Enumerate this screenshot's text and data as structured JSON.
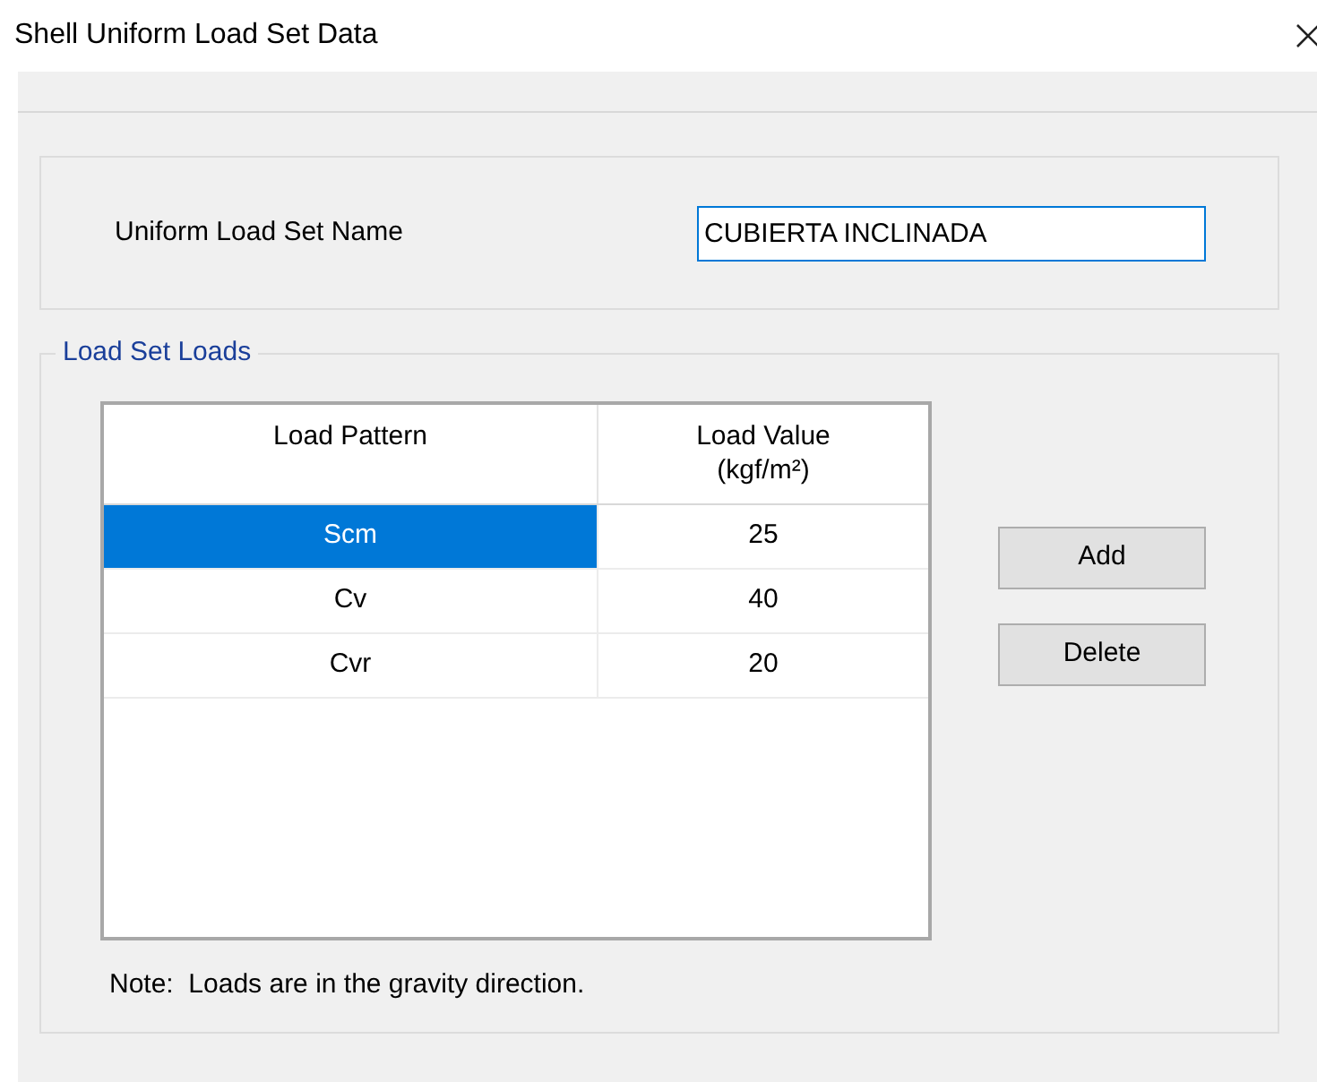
{
  "window": {
    "title": "Shell Uniform Load Set Data"
  },
  "name_field": {
    "label": "Uniform Load Set Name",
    "value": "CUBIERTA INCLINADA",
    "focused": true
  },
  "loads_group": {
    "legend": "Load Set Loads",
    "table": {
      "columns": [
        "Load Pattern",
        "Load Value\n(kgf/m²)"
      ],
      "rows": [
        {
          "cells": [
            "Scm",
            "25"
          ],
          "selected": true
        },
        {
          "cells": [
            "Cv",
            "40"
          ],
          "selected": false
        },
        {
          "cells": [
            "Cvr",
            "20"
          ],
          "selected": false
        }
      ]
    },
    "buttons": [
      "Add",
      "Delete"
    ],
    "note": "Note:  Loads are in the gravity direction."
  }
}
